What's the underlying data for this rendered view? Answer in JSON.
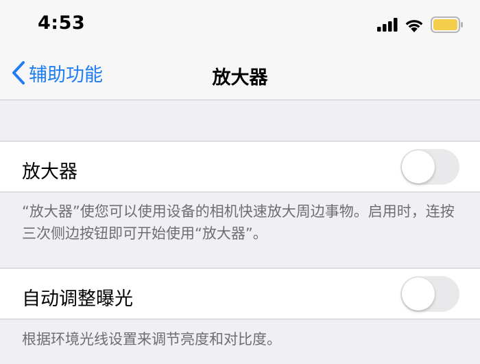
{
  "status_bar": {
    "time": "4:53",
    "icons": [
      "cellular-signal-icon",
      "wifi-icon",
      "battery-icon"
    ],
    "battery_color": "#f4ce4a"
  },
  "nav": {
    "back_label": "辅助功能",
    "title": "放大器",
    "accent_color": "#1f7cf2"
  },
  "settings": [
    {
      "label": "放大器",
      "enabled": false,
      "footer": "“放大器”使您可以使用设备的相机快速放大周边事物。启用时，连按三次侧边按钮即可开始使用“放大器”。"
    },
    {
      "label": "自动调整曝光",
      "enabled": false,
      "footer": "根据环境光线设置来调节亮度和对比度。"
    }
  ]
}
